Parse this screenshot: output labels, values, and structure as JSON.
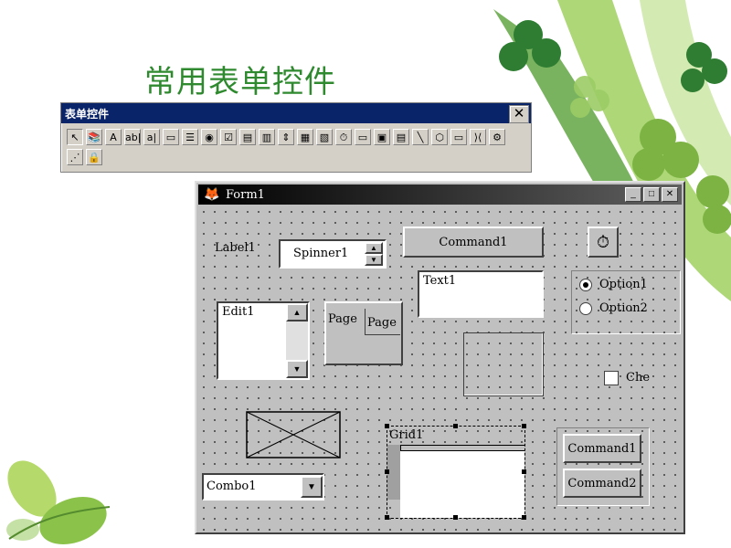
{
  "slide": {
    "title": "常用表单控件"
  },
  "toolbox": {
    "title": "表单控件",
    "close": "✕",
    "row1": [
      "↖",
      "📚",
      "A",
      "ab|",
      "a|",
      "▭",
      "☰",
      "◉",
      "☑",
      "▤",
      "▥",
      "⇕",
      "▦",
      "▧",
      "⏱",
      "▭",
      "▣",
      "▤",
      "╲",
      "⬡",
      "▭",
      "⟩⟨",
      "⚙"
    ],
    "row2": [
      "⋰",
      "🔒"
    ]
  },
  "form": {
    "title": "Form1",
    "minimize": "_",
    "maximize": "□",
    "close": "✕",
    "label1": "Label1",
    "spinner1": "Spinner1",
    "command1_top": "Command1",
    "text1": "Text1",
    "option1": "Option1",
    "option2": "Option2",
    "edit1": "Edit1",
    "page_tab1": "Page",
    "page_tab2": "Page",
    "checkbox_label": "Che",
    "grid1": "Grid1",
    "combo1": "Combo1",
    "group_command1": "Command1",
    "group_command2": "Command2"
  }
}
